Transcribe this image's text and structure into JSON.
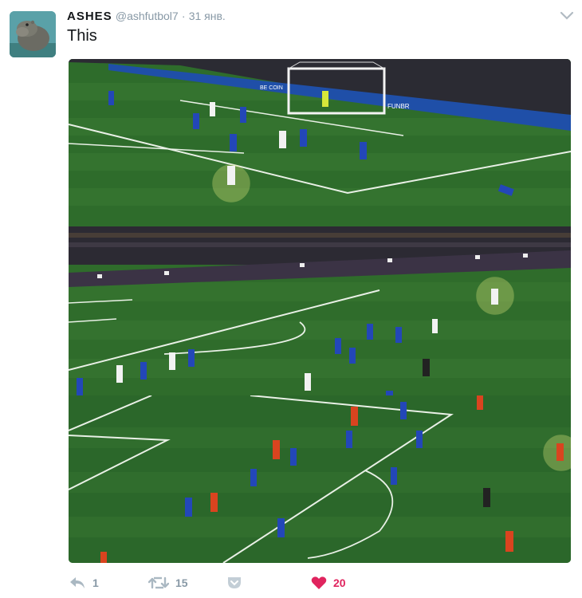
{
  "tweet": {
    "author_name": "ASHES",
    "author_handle": "@ashfutbol7",
    "separator": "·",
    "date": "31 янв.",
    "text": "This"
  },
  "media": {
    "panels": [
      {
        "ad_text_1": "BE COIN",
        "ad_text_2": "FUNBR"
      },
      {
        "ad_text_1": ""
      },
      {
        "ad_text_1": ""
      }
    ]
  },
  "actions": {
    "reply_count": "1",
    "retweet_count": "15",
    "like_count": "20",
    "like_color": "#e0245e"
  },
  "colors": {
    "pitch_dark": "#2d6b2b",
    "pitch_light": "#3c7d35",
    "line": "#e9f0e6",
    "highlight": "#d8e27a",
    "chelsea": "#2347b8",
    "liverpool": "#d9441f",
    "tottenham": "#f2f2f2"
  }
}
